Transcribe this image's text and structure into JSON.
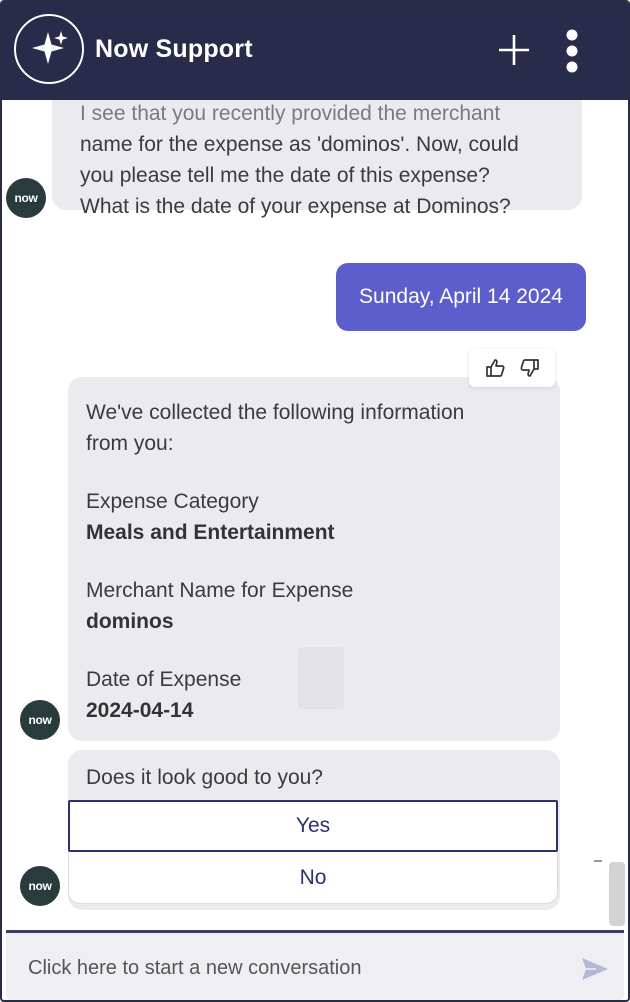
{
  "header": {
    "title": "Now Support",
    "logo_icon": "sparkle-icon",
    "new_chat_icon": "plus-icon",
    "menu_icon": "kebab-menu-icon",
    "bg_color": "#292b4a"
  },
  "avatar_text": "now",
  "messages": {
    "bot1": {
      "ghost_line": "I see that you recently provided the merchant",
      "lines": [
        "name for the expense as 'dominos'. Now, could",
        "you please tell me the date of this expense?",
        "What is the date of your expense at Dominos?"
      ]
    },
    "user1": {
      "text": "Sunday, April 14 2024",
      "color": "#5c5ecc"
    },
    "feedback": {
      "like_icon": "thumbs-up-icon",
      "dislike_icon": "thumbs-down-icon"
    },
    "bot2": {
      "intro_lines": [
        "We've collected the following information",
        "from you:"
      ],
      "fields": [
        {
          "label": "Expense Category",
          "value": "Meals and Entertainment"
        },
        {
          "label": "Merchant Name for Expense",
          "value": "dominos"
        },
        {
          "label": "Date of Expense",
          "value": "2024-04-14"
        }
      ]
    },
    "bot3": {
      "question": "Does it look good to you?",
      "options": [
        "Yes",
        "No"
      ]
    }
  },
  "input": {
    "placeholder": "Click here to start a new conversation",
    "send_icon": "send-icon"
  }
}
